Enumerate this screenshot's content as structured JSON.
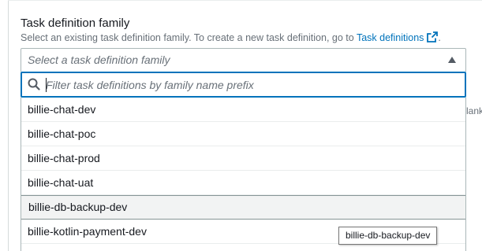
{
  "field": {
    "label": "Task definition family",
    "description_prefix": "Select an existing task definition family. To create a new task definition, go to ",
    "description_link": "Task definitions",
    "description_suffix": "."
  },
  "select": {
    "placeholder": "Select a task definition family"
  },
  "filter": {
    "placeholder": "Filter task definitions by family name prefix",
    "value": ""
  },
  "options": [
    {
      "label": "billie-chat-dev"
    },
    {
      "label": "billie-chat-poc"
    },
    {
      "label": "billie-chat-prod"
    },
    {
      "label": "billie-chat-uat"
    },
    {
      "label": "billie-db-backup-dev"
    },
    {
      "label": "billie-kotlin-payment-dev"
    }
  ],
  "hovered_option_index": 4,
  "tooltip": {
    "text": "billie-db-backup-dev"
  },
  "side_text": "lank",
  "colors": {
    "link": "#0073bb",
    "focus_border": "#0073bb",
    "hover_bg": "#f2f3f3"
  },
  "icons": {
    "external_link": "external-link-icon",
    "search": "search-icon",
    "caret": "caret-up-icon"
  }
}
